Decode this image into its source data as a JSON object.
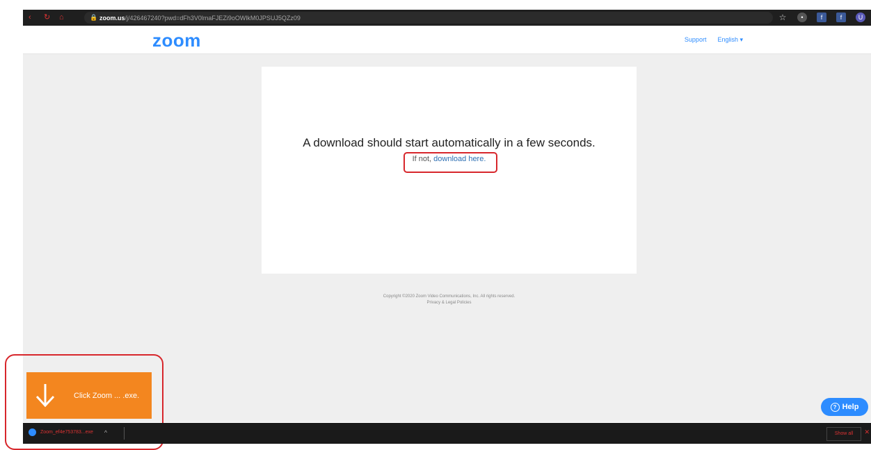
{
  "browser": {
    "url_host": "zoom.us",
    "url_path": "/j/426467240?pwd=dFh3V0lmaFJEZi9oOWlkM0JPSUJ5QZz09"
  },
  "header": {
    "logo": "zoom",
    "support_label": "Support",
    "language_label": "English ▾"
  },
  "main": {
    "message": "A download should start automatically in a few seconds.",
    "fallback_prefix": "If not,",
    "fallback_link": "download here."
  },
  "footer": {
    "copyright": "Copyright ©2020 Zoom Video Communications, Inc. All rights reserved.",
    "policies": "Privacy & Legal Policies"
  },
  "download_hint": {
    "text": "Click Zoom ... .exe."
  },
  "download_bar": {
    "filename": "Zoom_ef4e753783...exe",
    "show_all_label": "Show all"
  },
  "help": {
    "label": "Help"
  },
  "colors": {
    "brand": "#2d8cff",
    "hint_orange": "#f3861f",
    "highlight_red": "#d7262b"
  }
}
